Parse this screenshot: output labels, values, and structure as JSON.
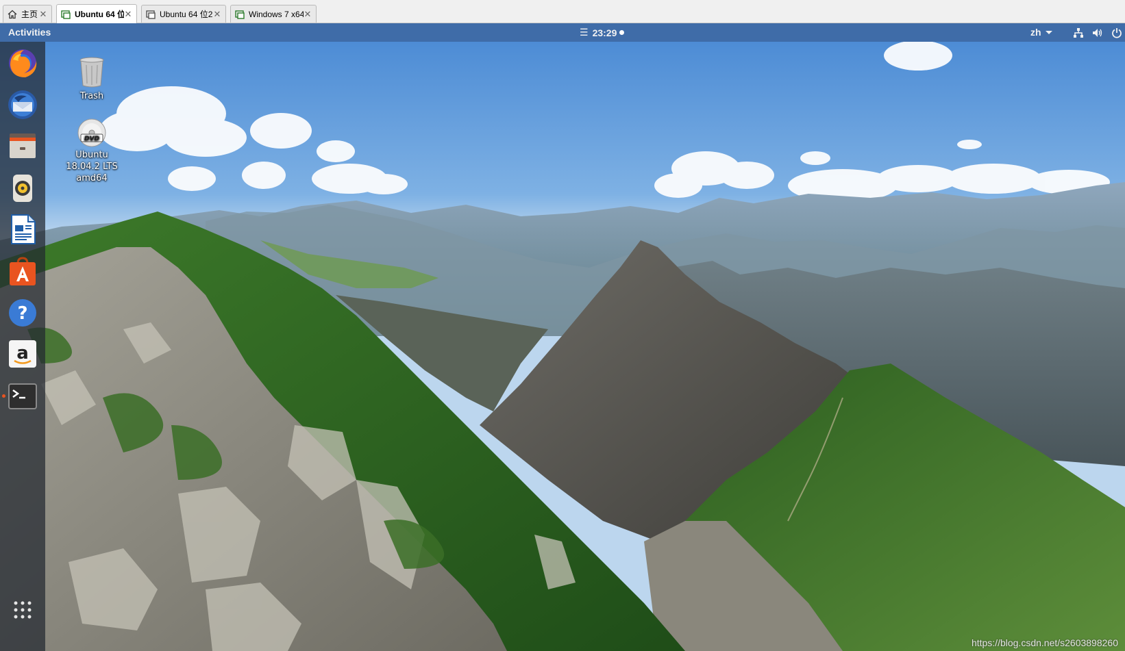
{
  "vm_tabs": [
    {
      "label": "主页",
      "icon": "home-icon",
      "active": false
    },
    {
      "label": "Ubuntu 64 位",
      "icon": "vm-icon",
      "active": true
    },
    {
      "label": "Ubuntu 64 位2",
      "icon": "vm-icon",
      "active": false
    },
    {
      "label": "Windows 7 x64",
      "icon": "vm-icon",
      "active": false
    }
  ],
  "topbar": {
    "activities": "Activities",
    "clock": "23:29",
    "language": "zh",
    "tray_icons": [
      "network-icon",
      "volume-icon",
      "power-icon"
    ]
  },
  "dock": {
    "items": [
      {
        "name": "firefox",
        "icon": "firefox-icon"
      },
      {
        "name": "thunderbird",
        "icon": "thunderbird-icon"
      },
      {
        "name": "files",
        "icon": "files-icon"
      },
      {
        "name": "rhythmbox",
        "icon": "rhythmbox-icon"
      },
      {
        "name": "libreoffice-writer",
        "icon": "writer-icon"
      },
      {
        "name": "ubuntu-software",
        "icon": "software-icon"
      },
      {
        "name": "help",
        "icon": "help-icon"
      },
      {
        "name": "amazon",
        "icon": "amazon-icon"
      },
      {
        "name": "terminal",
        "icon": "terminal-icon",
        "running": true
      }
    ],
    "show_apps": "apps-grid-icon"
  },
  "desktop": {
    "icons": [
      {
        "label": "Trash",
        "icon": "trash-icon"
      },
      {
        "label": "Ubuntu\n18.04.2 LTS\namd64",
        "icon": "dvd-icon"
      }
    ],
    "wallpaper": "mountain ridge landscape"
  },
  "watermark": "https://blog.csdn.net/s2603898260",
  "colors": {
    "topbar": "#3f6ca8",
    "dock": "#232830",
    "accent": "#e95420",
    "sky": "#5a95d8",
    "grass": "#2f6a24",
    "rock": "#8e8d86"
  }
}
